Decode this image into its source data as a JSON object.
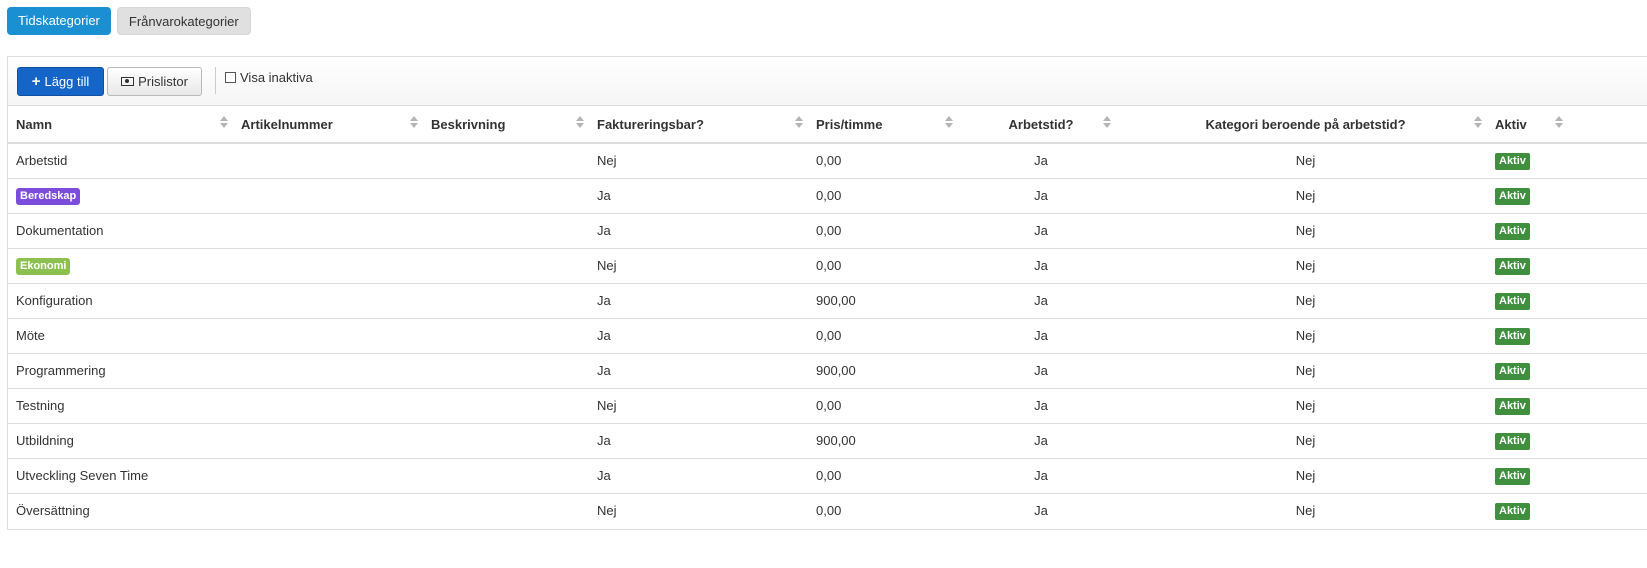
{
  "tabs": [
    {
      "label": "Tidskategorier",
      "active": true
    },
    {
      "label": "Frånvarokategorier",
      "active": false
    }
  ],
  "toolbar": {
    "add_label": "Lägg till",
    "pricelists_label": "Prislistor",
    "show_inactive_label": "Visa inaktiva"
  },
  "columns": [
    "Namn",
    "Artikelnummer",
    "Beskrivning",
    "Faktureringsbar?",
    "Pris/timme",
    "Arbetstid?",
    "Kategori beroende på arbetstid?",
    "Aktiv"
  ],
  "rows": [
    {
      "name": "Arbetstid",
      "article": "",
      "description": "",
      "billable": "Nej",
      "price": "0,00",
      "worktime": "Ja",
      "dependent": "Nej",
      "active": "Aktiv"
    },
    {
      "name": "Beredskap",
      "tag_color": "#7c4ddb",
      "article": "",
      "description": "",
      "billable": "Ja",
      "price": "0,00",
      "worktime": "Ja",
      "dependent": "Nej",
      "active": "Aktiv"
    },
    {
      "name": "Dokumentation",
      "article": "",
      "description": "",
      "billable": "Ja",
      "price": "0,00",
      "worktime": "Ja",
      "dependent": "Nej",
      "active": "Aktiv"
    },
    {
      "name": "Ekonomi",
      "tag_color": "#8cc152",
      "article": "",
      "description": "",
      "billable": "Nej",
      "price": "0,00",
      "worktime": "Ja",
      "dependent": "Nej",
      "active": "Aktiv"
    },
    {
      "name": "Konfiguration",
      "article": "",
      "description": "",
      "billable": "Ja",
      "price": "900,00",
      "worktime": "Ja",
      "dependent": "Nej",
      "active": "Aktiv"
    },
    {
      "name": "Möte",
      "article": "",
      "description": "",
      "billable": "Ja",
      "price": "0,00",
      "worktime": "Ja",
      "dependent": "Nej",
      "active": "Aktiv"
    },
    {
      "name": "Programmering",
      "article": "",
      "description": "",
      "billable": "Ja",
      "price": "900,00",
      "worktime": "Ja",
      "dependent": "Nej",
      "active": "Aktiv"
    },
    {
      "name": "Testning",
      "article": "",
      "description": "",
      "billable": "Nej",
      "price": "0,00",
      "worktime": "Ja",
      "dependent": "Nej",
      "active": "Aktiv"
    },
    {
      "name": "Utbildning",
      "article": "",
      "description": "",
      "billable": "Ja",
      "price": "900,00",
      "worktime": "Ja",
      "dependent": "Nej",
      "active": "Aktiv"
    },
    {
      "name": "Utveckling Seven Time",
      "article": "",
      "description": "",
      "billable": "Ja",
      "price": "0,00",
      "worktime": "Ja",
      "dependent": "Nej",
      "active": "Aktiv"
    },
    {
      "name": "Översättning",
      "article": "",
      "description": "",
      "billable": "Nej",
      "price": "0,00",
      "worktime": "Ja",
      "dependent": "Nej",
      "active": "Aktiv"
    }
  ],
  "colors": {
    "primary": "#1a8fd1",
    "add_button": "#1565c8",
    "active_badge": "#3f8f3f"
  },
  "icons": {
    "add": "plus-icon",
    "pricelists": "money-icon",
    "sort": "sort-icon"
  }
}
